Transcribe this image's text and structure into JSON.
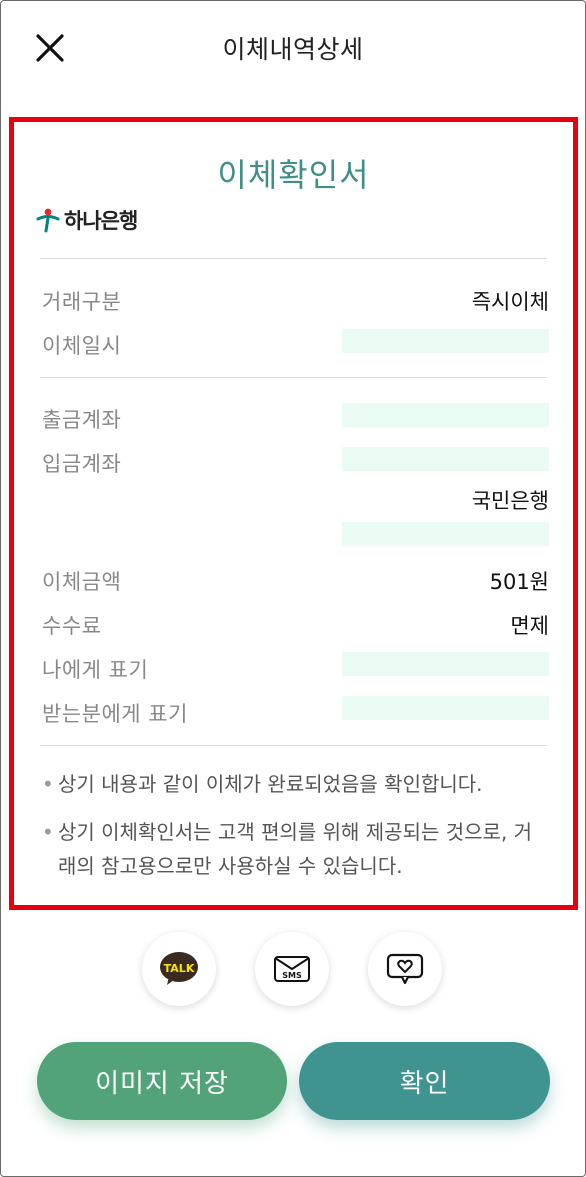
{
  "header": {
    "title": "이체내역상세"
  },
  "receipt": {
    "title": "이체확인서",
    "bank_name": "하나은행",
    "rows": {
      "transaction_type": {
        "label": "거래구분",
        "value": "즉시이체"
      },
      "transfer_datetime": {
        "label": "이체일시"
      },
      "withdraw_account": {
        "label": "출금계좌"
      },
      "deposit_account": {
        "label": "입금계좌",
        "bank": "국민은행"
      },
      "amount": {
        "label": "이체금액",
        "value": "501원"
      },
      "fee": {
        "label": "수수료",
        "value": "면제"
      },
      "memo_to_me": {
        "label": "나에게 표기"
      },
      "memo_to_recipient": {
        "label": "받는분에게 표기"
      }
    },
    "notes": [
      "상기 내용과 같이 이체가 완료되었음을 확인합니다.",
      "상기 이체확인서는 고객 편의를 위해 제공되는 것으로, 거래의 참고용으로만 사용하실 수 있습니다."
    ]
  },
  "share": {
    "talk_label": "TALK",
    "sms_label": "SMS"
  },
  "buttons": {
    "save_image": "이미지 저장",
    "confirm": "확인"
  },
  "colors": {
    "accent_teal": "#3f8f86",
    "save_green": "#52a27a",
    "confirm_teal": "#3f9490",
    "highlight_border": "#e8000e",
    "masked_fill": "#e9fbf3"
  }
}
